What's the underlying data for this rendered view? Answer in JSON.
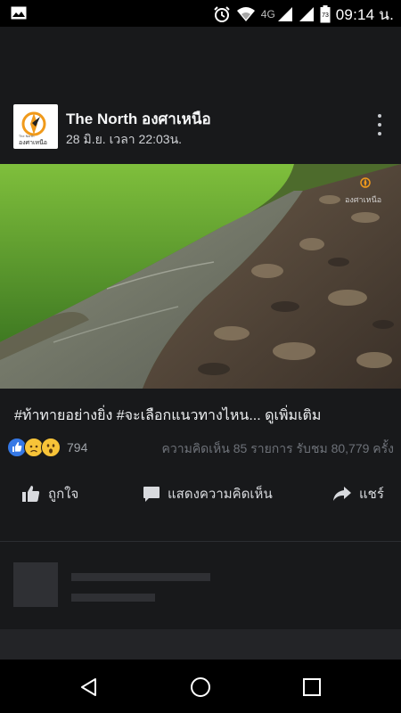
{
  "status_bar": {
    "network": "4G",
    "battery_level": "73",
    "time": "09:14 น.",
    "icons": [
      "image-icon",
      "alarm-icon",
      "wifi-icon",
      "signal-icon",
      "signal-icon",
      "battery-icon"
    ]
  },
  "post": {
    "page_name": "The North องศาเหนือ",
    "date": "28 มิ.ย. เวลา 22:03น.",
    "logo_text": "องศาเหนือ",
    "logo_small": "The North",
    "watermark": "องศาเหนือ",
    "caption_tag1": "#ท้าทายอย่างยิ่ง",
    "caption_tag2": "#จะเลือกแนวทางไหน",
    "caption_ellipsis": "...",
    "caption_more": "ดูเพิ่มเติม",
    "reaction_count": "794",
    "stats": "ความคิดเห็น 85 รายการ รับชม 80,779 ครั้ง",
    "reactions": [
      "like",
      "sad",
      "wow"
    ]
  },
  "actions": {
    "like": "ถูกใจ",
    "comment": "แสดงความคิดเห็น",
    "share": "แชร์"
  },
  "colors": {
    "background": "#18191b",
    "like_blue": "#3578e5",
    "emoji_yellow": "#f7c338",
    "logo_orange": "#f09a1b"
  },
  "navbar": {
    "icons": [
      "back-icon",
      "home-icon",
      "recents-icon"
    ]
  }
}
